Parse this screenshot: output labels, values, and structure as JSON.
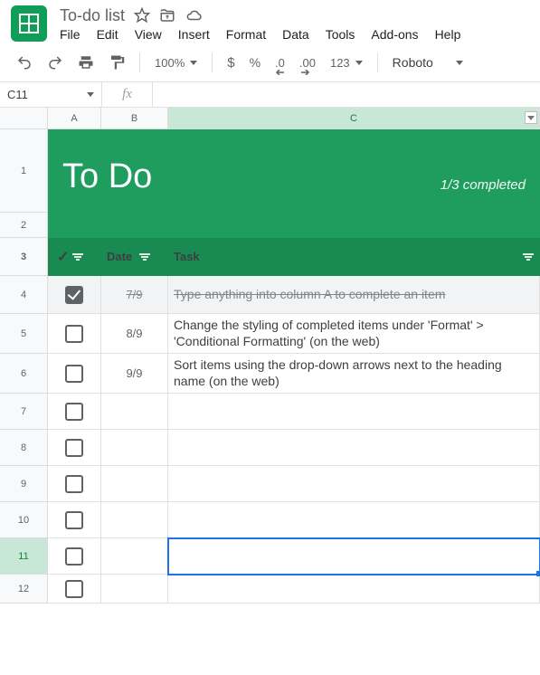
{
  "doc": {
    "title": "To-do list"
  },
  "menu": {
    "file": "File",
    "edit": "Edit",
    "view": "View",
    "insert": "Insert",
    "format": "Format",
    "data": "Data",
    "tools": "Tools",
    "addons": "Add-ons",
    "help": "Help"
  },
  "toolbar": {
    "zoom": "100%",
    "currency": "$",
    "percent": "%",
    "dec_dec": ".0",
    "inc_dec": ".00",
    "numfmt": "123",
    "font": "Roboto"
  },
  "namebox": "C11",
  "fx": "fx",
  "columns": {
    "A": "A",
    "B": "B",
    "C": "C"
  },
  "banner": {
    "title": "To Do",
    "subtitle": "1/3 completed"
  },
  "headers": {
    "check": "✓",
    "date": "Date",
    "task": "Task"
  },
  "rows": [
    {
      "n": "1"
    },
    {
      "n": "2"
    },
    {
      "n": "3"
    },
    {
      "n": "4"
    },
    {
      "n": "5"
    },
    {
      "n": "6"
    },
    {
      "n": "7"
    },
    {
      "n": "8"
    },
    {
      "n": "9"
    },
    {
      "n": "10"
    },
    {
      "n": "11"
    },
    {
      "n": "12"
    }
  ],
  "tasks": [
    {
      "done": true,
      "date": "7/9",
      "text": "Type anything into column A to complete an item"
    },
    {
      "done": false,
      "date": "8/9",
      "text": "Change the styling of completed items under 'Format' > 'Conditional Formatting' (on the web)"
    },
    {
      "done": false,
      "date": "9/9",
      "text": "Sort items using the drop-down arrows next to the heading name (on the web)"
    }
  ]
}
